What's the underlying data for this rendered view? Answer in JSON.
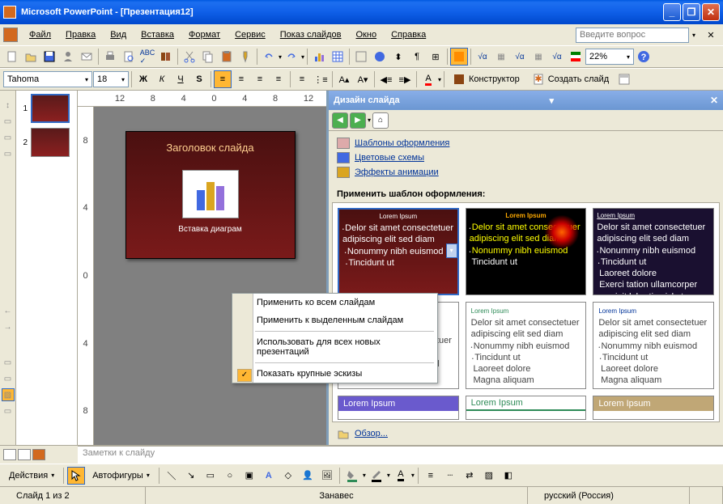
{
  "titlebar": {
    "app_name": "Microsoft PowerPoint",
    "doc_name": "[Презентация12]"
  },
  "menu": {
    "file": "Файл",
    "edit": "Правка",
    "view": "Вид",
    "insert": "Вставка",
    "format": "Формат",
    "tools": "Сервис",
    "slideshow": "Показ слайдов",
    "window": "Окно",
    "help": "Справка",
    "help_placeholder": "Введите вопрос"
  },
  "toolbar1": {
    "zoom": "22%"
  },
  "toolbar2": {
    "font": "Tahoma",
    "size": "18",
    "bold": "Ж",
    "italic": "К",
    "underline": "Ч",
    "shadow": "S",
    "designer": "Конструктор",
    "new_slide": "Создать слайд"
  },
  "ruler_h": [
    "12",
    "8",
    "4",
    "0",
    "4",
    "8",
    "12"
  ],
  "ruler_v": [
    "8",
    "4",
    "0",
    "4",
    "8"
  ],
  "thumbs": [
    {
      "num": "1",
      "selected": true
    },
    {
      "num": "2",
      "selected": false
    }
  ],
  "slide": {
    "title": "Заголовок слайда",
    "subtitle": "Вставка диаграм"
  },
  "context_menu": {
    "apply_all": "Применить ко всем слайдам",
    "apply_selected": "Применить к выделенным слайдам",
    "use_new": "Использовать для всех новых презентаций",
    "large_thumbs": "Показать крупные эскизы"
  },
  "task_pane": {
    "title": "Дизайн слайда",
    "link_templates": "Шаблоны оформления",
    "link_colors": "Цветовые схемы",
    "link_effects": "Эффекты анимации",
    "section": "Применить шаблон оформления:",
    "browse": "Обзор...",
    "designs": {
      "lorem_title": "Lorem Ipsum",
      "bullet1": "Delor sit amet consectetuer adipiscing elit sed diam",
      "bullet2": "Nonummy nibh euismod",
      "bullet3": "Tincidunt ut",
      "sub1": "Laoreet dolore",
      "sub2": "Magna aliquam",
      "sub3": "Exerci tation ullamcorper suscipit lobortis nisl ut aliquip ex ea com"
    }
  },
  "notes": "Заметки к слайду",
  "bottom_toolbar": {
    "actions": "Действия",
    "autoshapes": "Автофигуры"
  },
  "statusbar": {
    "slide_pos": "Слайд 1 из 2",
    "design_name": "Занавес",
    "language": "русский (Россия)"
  }
}
